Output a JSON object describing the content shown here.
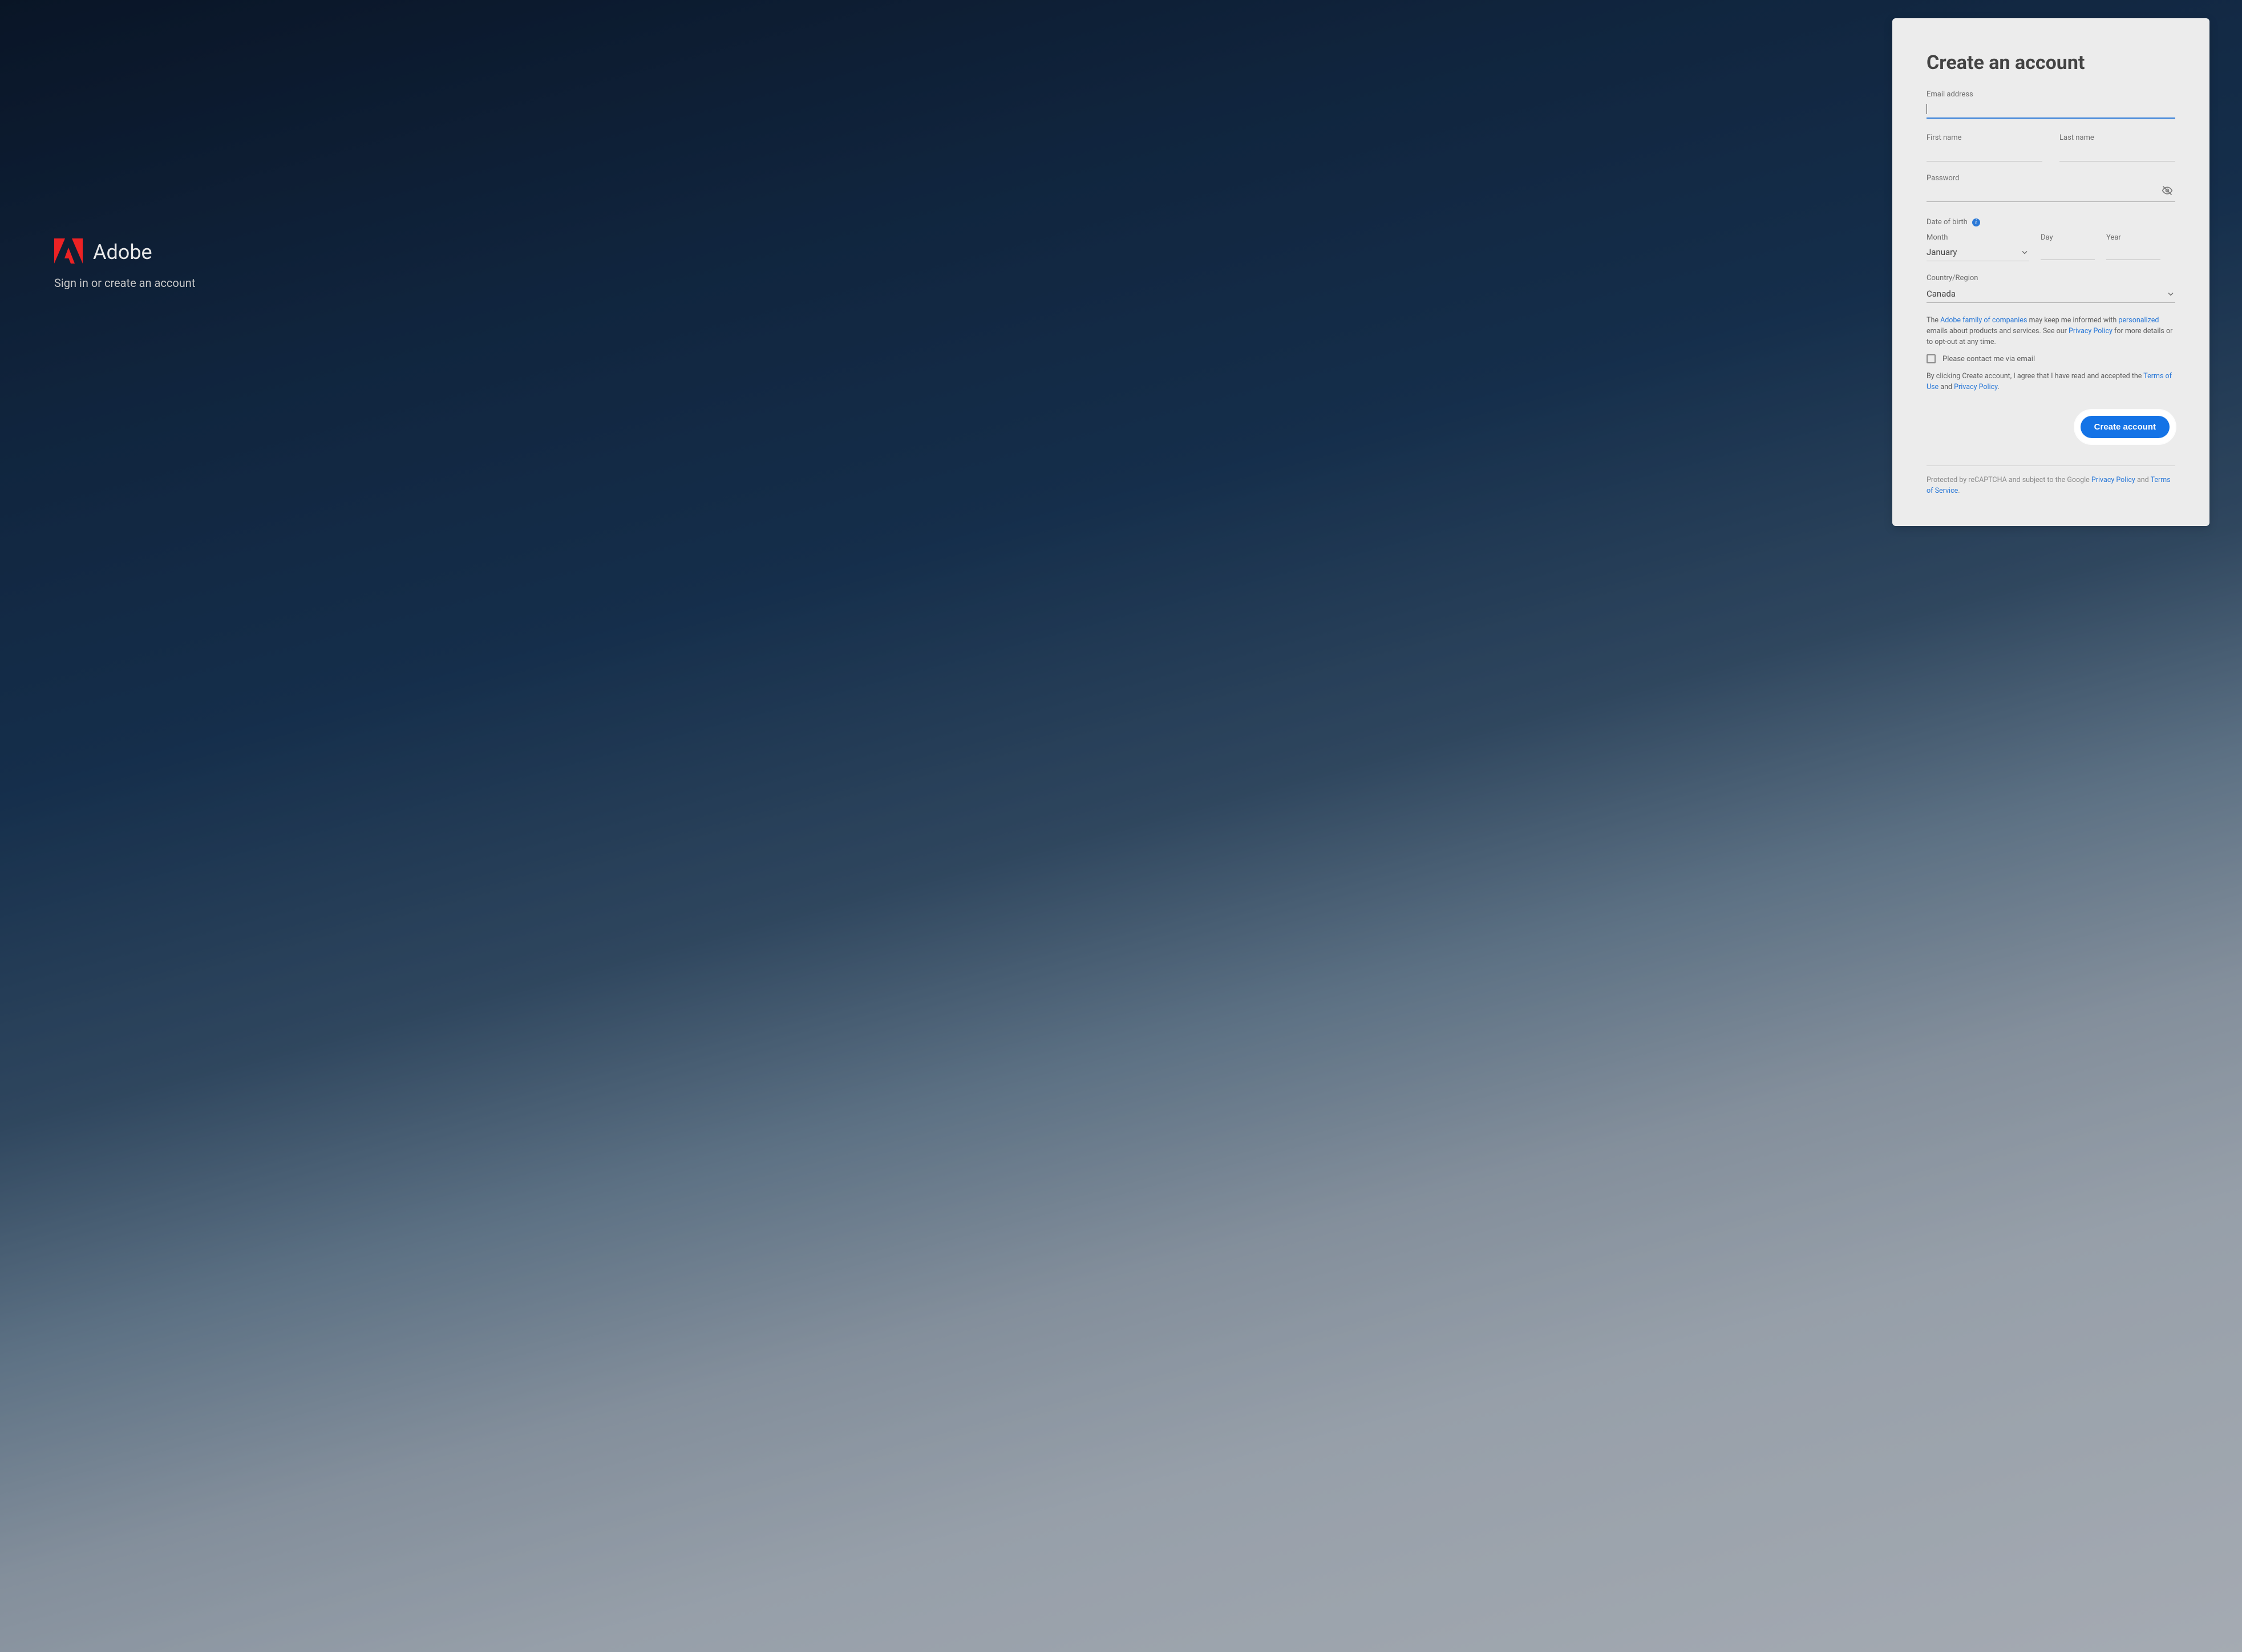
{
  "brand": {
    "name": "Adobe",
    "subtitle": "Sign in or create an account"
  },
  "form": {
    "title": "Create an account",
    "email": {
      "label": "Email address",
      "value": ""
    },
    "first_name": {
      "label": "First name",
      "value": ""
    },
    "last_name": {
      "label": "Last name",
      "value": ""
    },
    "password": {
      "label": "Password",
      "value": ""
    },
    "dob": {
      "label": "Date of birth",
      "month": {
        "label": "Month",
        "value": "January"
      },
      "day": {
        "label": "Day",
        "value": ""
      },
      "year": {
        "label": "Year",
        "value": ""
      }
    },
    "country": {
      "label": "Country/Region",
      "value": "Canada"
    },
    "marketing": {
      "prefix": "The ",
      "link1": "Adobe family of companies",
      "mid1": " may keep me informed with ",
      "link2": "personalized",
      "mid2": " emails about products and services. See our ",
      "link3": "Privacy Policy",
      "suffix": " for more details or to opt-out at any time."
    },
    "contact_checkbox": {
      "label": "Please contact me via email",
      "checked": false
    },
    "agreement": {
      "prefix": "By clicking Create account, I agree that I have read and accepted the ",
      "link1": "Terms of Use",
      "mid": " and ",
      "link2": "Privacy Policy",
      "suffix": "."
    },
    "submit_label": "Create account",
    "recaptcha": {
      "prefix": "Protected by reCAPTCHA and subject to the Google ",
      "link1": "Privacy Policy",
      "mid": " and ",
      "link2": "Terms of Service",
      "suffix": "."
    }
  }
}
